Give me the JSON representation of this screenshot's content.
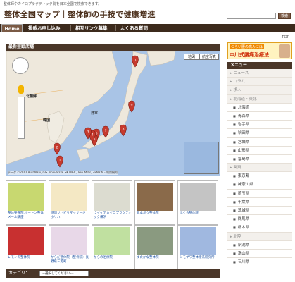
{
  "header": {
    "tagline": "整体師やカイロプラクティック院を日本全国で検索できます。",
    "site_title": "整体全国マップ｜整体師の手技で健康増進",
    "search_placeholder": "",
    "search_button": "検索"
  },
  "nav": {
    "items": [
      "Home",
      "掲載お申し込み",
      "相互リンク募集",
      "よくある質問"
    ]
  },
  "top_link": "TOP",
  "map_section": {
    "header": "最新登録店舗",
    "map_button": "地図",
    "satellite_button": "航空写真",
    "attribution": "データ ©2012 AutoNavi, GIS Innovatsia, SK M&C, Tele Atlas, ZENRIN - 利用規約",
    "labels": {
      "hokkaido": "北朝鮮",
      "korea": "韓国",
      "japan": "日本"
    }
  },
  "thumbnails": [
    {
      "caption": "整体整骨院.ポートン整体メール講座",
      "color": "#c8d870"
    },
    {
      "caption": "訪問リハビリマッサージ ホリハ",
      "color": "#f4e8c4"
    },
    {
      "caption": "ウイケアカイロプラクティック横浜",
      "color": "#dcdcd0"
    },
    {
      "caption": "日本ボウ整体院",
      "color": "#8a6a4a"
    },
    {
      "caption": "ふくら整体院",
      "color": "#c4c4c4"
    },
    {
      "caption": "レモンの整体院",
      "color": "#c83030"
    },
    {
      "caption": "からだ整体院（整骨院）長野県三芳町",
      "color": "#e8d8e8"
    },
    {
      "caption": "からの治療院",
      "color": "#c0e0a0"
    },
    {
      "caption": "ゆたかな整体院",
      "color": "#8a9a80"
    },
    {
      "caption": "シモザワ整体療法研究所",
      "color": "#a0b8e0"
    }
  ],
  "category_bar": {
    "label": "カテゴリ：",
    "select_value": "---選択してください---"
  },
  "banner": {
    "top": "つらい腰の痛みには",
    "main": "中川式腰痛治療法"
  },
  "menu": {
    "header": "メニュー",
    "items": [
      {
        "label": "ニュース",
        "type": "cat"
      },
      {
        "label": "コラム",
        "type": "cat"
      },
      {
        "label": "求人",
        "type": "cat"
      },
      {
        "label": "北海道・東北",
        "type": "cat"
      },
      {
        "label": "北海道",
        "type": "sub"
      },
      {
        "label": "青森県",
        "type": "sub"
      },
      {
        "label": "岩手県",
        "type": "sub"
      },
      {
        "label": "秋田県",
        "type": "sub"
      },
      {
        "label": "宮城県",
        "type": "sub"
      },
      {
        "label": "山形県",
        "type": "sub"
      },
      {
        "label": "福島県",
        "type": "sub"
      },
      {
        "label": "関東",
        "type": "cat"
      },
      {
        "label": "東京都",
        "type": "sub"
      },
      {
        "label": "神奈川県",
        "type": "sub"
      },
      {
        "label": "埼玉県",
        "type": "sub"
      },
      {
        "label": "千葉県",
        "type": "sub"
      },
      {
        "label": "茨城県",
        "type": "sub"
      },
      {
        "label": "群馬県",
        "type": "sub"
      },
      {
        "label": "栃木県",
        "type": "sub"
      },
      {
        "label": "北陸",
        "type": "cat"
      },
      {
        "label": "新潟県",
        "type": "sub"
      },
      {
        "label": "富山県",
        "type": "sub"
      },
      {
        "label": "石川県",
        "type": "sub"
      }
    ]
  },
  "markers": [
    "10",
    "9",
    "8",
    "7",
    "6",
    "5",
    "4",
    "3",
    "2",
    "1"
  ]
}
